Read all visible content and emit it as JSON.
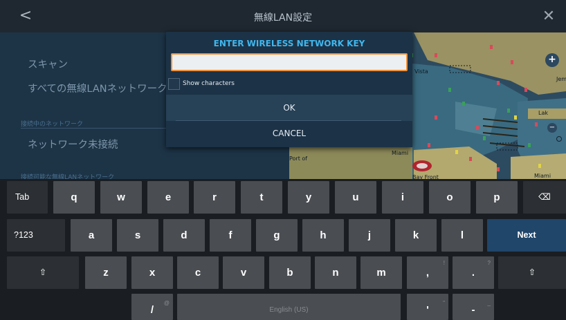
{
  "titlebar": {
    "back_icon": "chevron-left-icon",
    "back_glyph": "<",
    "title": "無線LAN設定",
    "close_icon": "close-icon",
    "close_glyph": "✕"
  },
  "settings": {
    "scan": "スキャン",
    "all_networks": "すべての無線LANネットワークを",
    "connected_header": "接続中のネットワーク",
    "not_connected": "ネットワーク未接続",
    "available_header": "接続可能な無線LANネットワーク"
  },
  "map": {
    "labels": {
      "vista": "Vista",
      "miami": "Miami",
      "bay_front": "Bay Front",
      "portof": "Port of",
      "miami_beach": "Miami Beac",
      "lak": "Lak",
      "jem": "Jem"
    },
    "zoom_in": "+",
    "zoom_out": "−"
  },
  "dialog": {
    "title": "ENTER WIRELESS NETWORK KEY",
    "input_value": "",
    "show_characters": "Show characters",
    "ok": "OK",
    "cancel": "CANCEL"
  },
  "keyboard": {
    "row1": {
      "tab": "Tab",
      "keys": [
        "q",
        "w",
        "e",
        "r",
        "t",
        "y",
        "u",
        "i",
        "o",
        "p"
      ],
      "backspace_icon": "backspace-icon",
      "backspace_glyph": "⌫"
    },
    "row2": {
      "num": "?123",
      "keys": [
        "a",
        "s",
        "d",
        "f",
        "g",
        "h",
        "j",
        "k",
        "l"
      ],
      "next": "Next"
    },
    "row3": {
      "shift_icon": "shift-icon",
      "shift_glyph": "⇧",
      "keys": [
        "z",
        "x",
        "c",
        "v",
        "b",
        "n",
        "m"
      ],
      "comma": ",",
      "comma_hint": "!",
      "period": ".",
      "period_hint": "?"
    },
    "row4": {
      "slash": "/",
      "slash_hint": "@",
      "space": "English (US)",
      "apostrophe": "'",
      "apostrophe_hint": "\"",
      "dash": "-",
      "dash_hint": "_"
    }
  },
  "colors": {
    "title_accent": "#3fb7ee",
    "input_border": "#f0923a",
    "next_key": "#20466a",
    "key_bg": "#4a4d52"
  }
}
